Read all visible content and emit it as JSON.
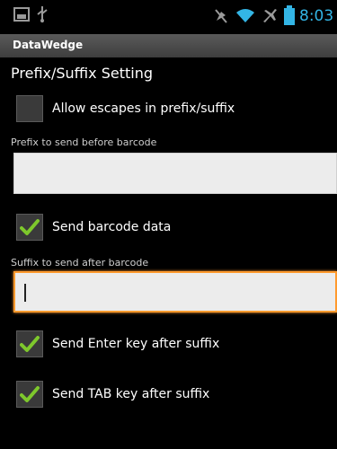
{
  "statusbar": {
    "time": "8:03",
    "icons": [
      "picture-icon",
      "usb-icon",
      "mute-icon",
      "wifi-icon",
      "airplane-icon",
      "battery-icon"
    ],
    "accent": "#33b5e5"
  },
  "titlebar": {
    "title": "DataWedge"
  },
  "section": {
    "heading": "Prefix/Suffix Setting"
  },
  "allow_escapes": {
    "label": "Allow escapes in prefix/suffix",
    "checked": false
  },
  "prefix": {
    "label": "Prefix to send before barcode",
    "value": ""
  },
  "send_barcode": {
    "label": "Send barcode data",
    "checked": true
  },
  "suffix": {
    "label": "Suffix to send after barcode",
    "value": ""
  },
  "send_enter": {
    "label": "Send Enter key after suffix",
    "checked": true
  },
  "send_tab": {
    "label": "Send TAB key after suffix",
    "checked": true
  },
  "colors": {
    "check": "#7ec82c",
    "focus": "#ff9a2e"
  }
}
